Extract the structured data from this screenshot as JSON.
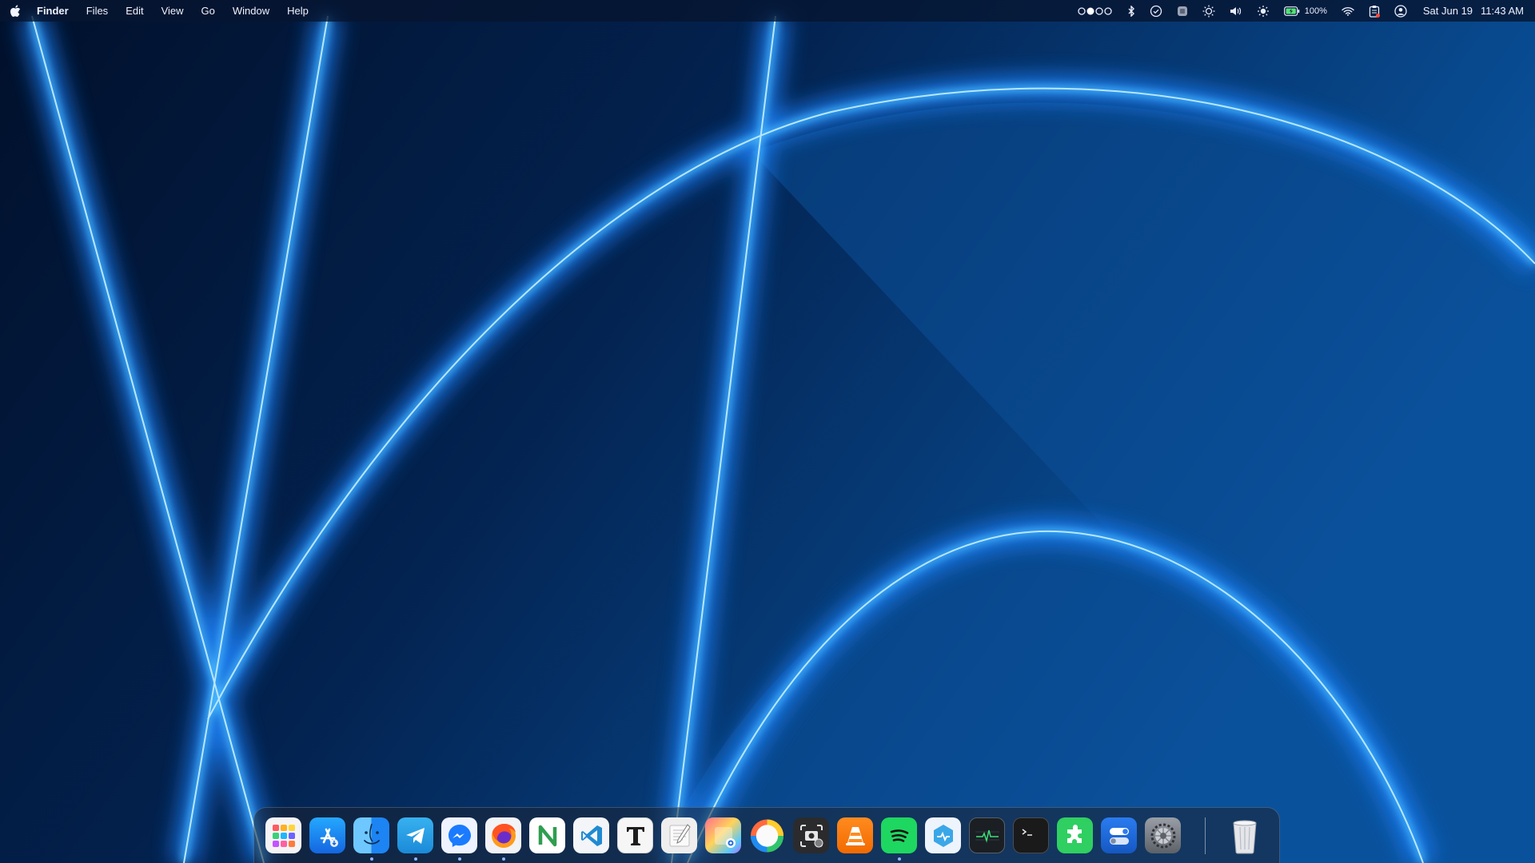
{
  "menubar": {
    "apple_icon": "apple-logo-icon",
    "app_name": "Finder",
    "menus": [
      "Files",
      "Edit",
      "View",
      "Go",
      "Window",
      "Help"
    ],
    "status_icons": [
      "workspace-dots-icon",
      "bluetooth-icon",
      "checkmark-circle-icon",
      "screen-record-icon",
      "brightness-icon",
      "volume-icon",
      "night-light-icon",
      "battery-icon",
      "wifi-icon",
      "clipboard-icon",
      "user-account-icon"
    ],
    "battery_text": "100%",
    "date": "Sat Jun 19",
    "time": "11:43 AM"
  },
  "dock": {
    "apps": [
      {
        "name": "launchpad",
        "running": false
      },
      {
        "name": "app-store",
        "running": false
      },
      {
        "name": "finder",
        "running": true
      },
      {
        "name": "telegram",
        "running": true
      },
      {
        "name": "messenger",
        "running": true
      },
      {
        "name": "firefox",
        "running": true
      },
      {
        "name": "notion-like-n",
        "running": false
      },
      {
        "name": "visual-studio-code",
        "running": false
      },
      {
        "name": "typora",
        "running": false
      },
      {
        "name": "text-editor",
        "running": false
      },
      {
        "name": "photo-viewer",
        "running": false
      },
      {
        "name": "browser-circle",
        "running": false
      },
      {
        "name": "screenshot",
        "running": false
      },
      {
        "name": "vlc",
        "running": false
      },
      {
        "name": "spotify",
        "running": true
      },
      {
        "name": "system-info",
        "running": false
      },
      {
        "name": "activity-monitor",
        "running": false
      },
      {
        "name": "terminal",
        "running": false
      },
      {
        "name": "extensions",
        "running": false
      },
      {
        "name": "toggle-settings",
        "running": false
      },
      {
        "name": "system-settings",
        "running": false
      }
    ],
    "trash": "trash"
  },
  "colors": {
    "wallpaper_dark": "#021029",
    "wallpaper_mid": "#0a4a90",
    "glow": "#3aa8ff",
    "menubar_bg": "#061430"
  }
}
